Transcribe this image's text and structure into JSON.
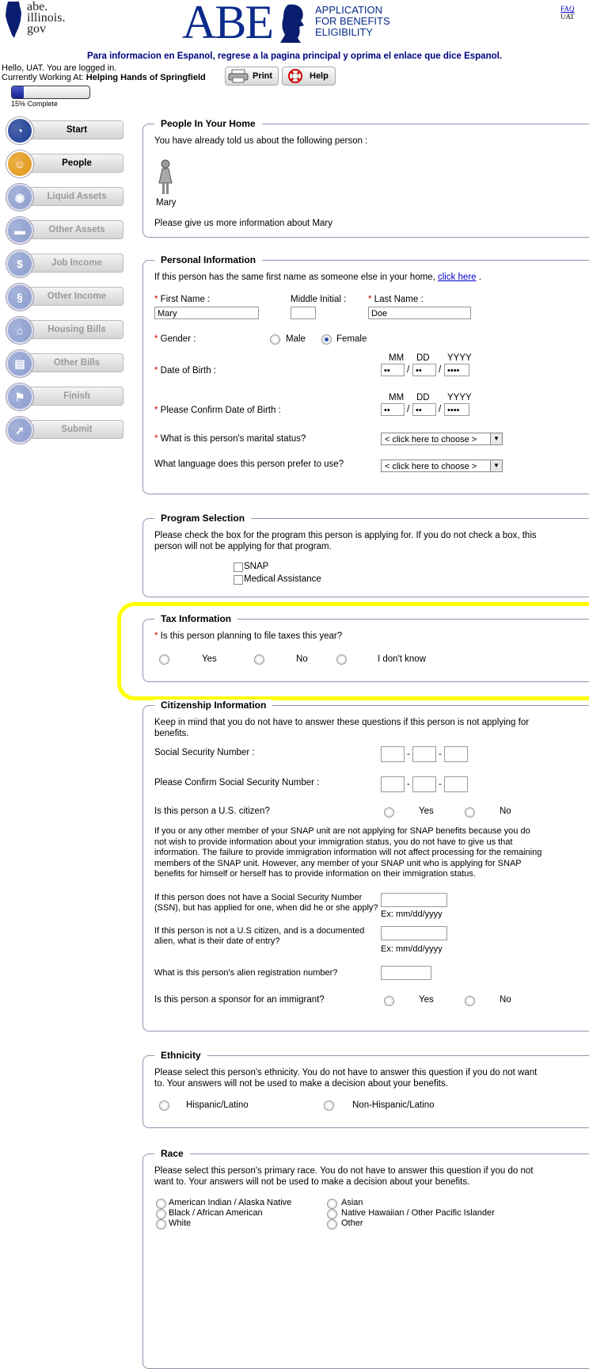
{
  "header": {
    "site_logo_lines": [
      "abe.",
      "illinois.",
      "gov"
    ],
    "brand": "ABE",
    "brand_sub": [
      "APPLICATION",
      "FOR BENEFITS",
      "ELIGIBILITY"
    ],
    "faq": "FAQ",
    "user_code": "UAT",
    "espanol_notice": "Para informacion en Espanol, regrese a la pagina principal y oprima el enlace que dice Espanol.",
    "hello": "Hello, UAT. You are logged in.",
    "working_at_label": "Currently Working At:",
    "working_at_value": "Helping Hands of Springfield",
    "print_label": "Print",
    "help_label": "Help",
    "progress_percent": 15,
    "progress_label": "15% Complete"
  },
  "sidebar": {
    "items": [
      {
        "label": "Start",
        "icon": "stopwatch-icon",
        "color": "#1e3f96",
        "enabled": true
      },
      {
        "label": "People",
        "icon": "people-icon",
        "color": "#e59a18",
        "enabled": true
      },
      {
        "label": "Liquid Assets",
        "icon": "piggy-bank-icon",
        "color": "#8ea0d0",
        "enabled": false
      },
      {
        "label": "Other Assets",
        "icon": "car-icon",
        "color": "#8ea0d0",
        "enabled": false
      },
      {
        "label": "Job Income",
        "icon": "dollar-icon",
        "color": "#8ea0d0",
        "enabled": false
      },
      {
        "label": "Other Income",
        "icon": "money-icon",
        "color": "#8ea0d0",
        "enabled": false
      },
      {
        "label": "Housing Bills",
        "icon": "house-icon",
        "color": "#8ea0d0",
        "enabled": false
      },
      {
        "label": "Other Bills",
        "icon": "bill-icon",
        "color": "#8ea0d0",
        "enabled": false
      },
      {
        "label": "Finish",
        "icon": "flag-icon",
        "color": "#8ea0d0",
        "enabled": false
      },
      {
        "label": "Submit",
        "icon": "send-icon",
        "color": "#8ea0d0",
        "enabled": false
      }
    ]
  },
  "people": {
    "legend": "People In Your Home",
    "intro": "You have already told us about the following person :",
    "person_name": "Mary",
    "more_info": "Please give us more information about Mary"
  },
  "personal": {
    "legend": "Personal Information",
    "same_name_text": "If this person has the same first name as someone else in your home,",
    "click_here": "click here",
    "first_name_label": "First Name :",
    "first_name_value": "Mary",
    "middle_initial_label": "Middle Initial :",
    "middle_initial_value": "",
    "last_name_label": "Last Name :",
    "last_name_value": "Doe",
    "gender_label": "Gender :",
    "male": "Male",
    "female": "Female",
    "gender_selected": "Female",
    "mm": "MM",
    "dd": "DD",
    "yyyy": "YYYY",
    "dob_label": "Date of Birth :",
    "confirm_dob_label": "Please Confirm Date of Birth :",
    "masked_2": "••",
    "masked_4": "••••",
    "marital_label": "What is this person's marital status?",
    "language_label": "What language does this person prefer to use?",
    "choose": "< click here to choose >"
  },
  "program": {
    "legend": "Program Selection",
    "text": "Please check the box for the program this person is applying for. If you do not check a box, this person will not be applying for that program.",
    "snap": "SNAP",
    "medical": "Medical Assistance"
  },
  "tax": {
    "legend": "Tax Information",
    "question": "Is this person planning to file taxes this year?",
    "yes": "Yes",
    "no": "No",
    "dont_know": "I don't know"
  },
  "citizenship": {
    "legend": "Citizenship Information",
    "intro": "Keep in mind that you do not have to answer these questions if this person is not applying for benefits.",
    "ssn_label": "Social Security Number :",
    "confirm_ssn_label": "Please Confirm Social Security Number :",
    "citizen_q": "Is this person a U.S. citizen?",
    "yes": "Yes",
    "no": "No",
    "snap_note": "If you or any other member of your SNAP unit are not applying for SNAP benefits because you do not wish to provide information about your immigration status, you do not have to give us that information. The failure to provide immigration information will not affect processing for the remaining members of the SNAP unit. However, any member of your SNAP unit who is applying for SNAP benefits for himself or herself has to provide information on their immigration status.",
    "ssn_applied_q": "If this person does not have a Social Security Number (SSN), but has applied for one, when did he or she apply?",
    "date_hint": "Ex: mm/dd/yyyy",
    "entry_q": "If this person is not a U.S citizen, and is a documented alien, what is their date of entry?",
    "alien_q": "What is this person's alien registration number?",
    "sponsor_q": "Is this person a sponsor for an immigrant?"
  },
  "ethnicity": {
    "legend": "Ethnicity",
    "text": "Please select this person's ethnicity. You do not have to answer this question if you do not want to. Your answers will not be used to make a decision about your benefits.",
    "hispanic": "Hispanic/Latino",
    "non_hispanic": "Non-Hispanic/Latino"
  },
  "race": {
    "legend": "Race",
    "text": "Please select this person's primary race. You do not have to answer this question if you do not want to. Your answers will not be used to make a decision about your benefits.",
    "options_left": [
      "American Indian / Alaska Native",
      "Black / African American",
      "White"
    ],
    "options_right": [
      "Asian",
      "Native Hawaiian / Other Pacific Islander",
      "Other"
    ]
  }
}
